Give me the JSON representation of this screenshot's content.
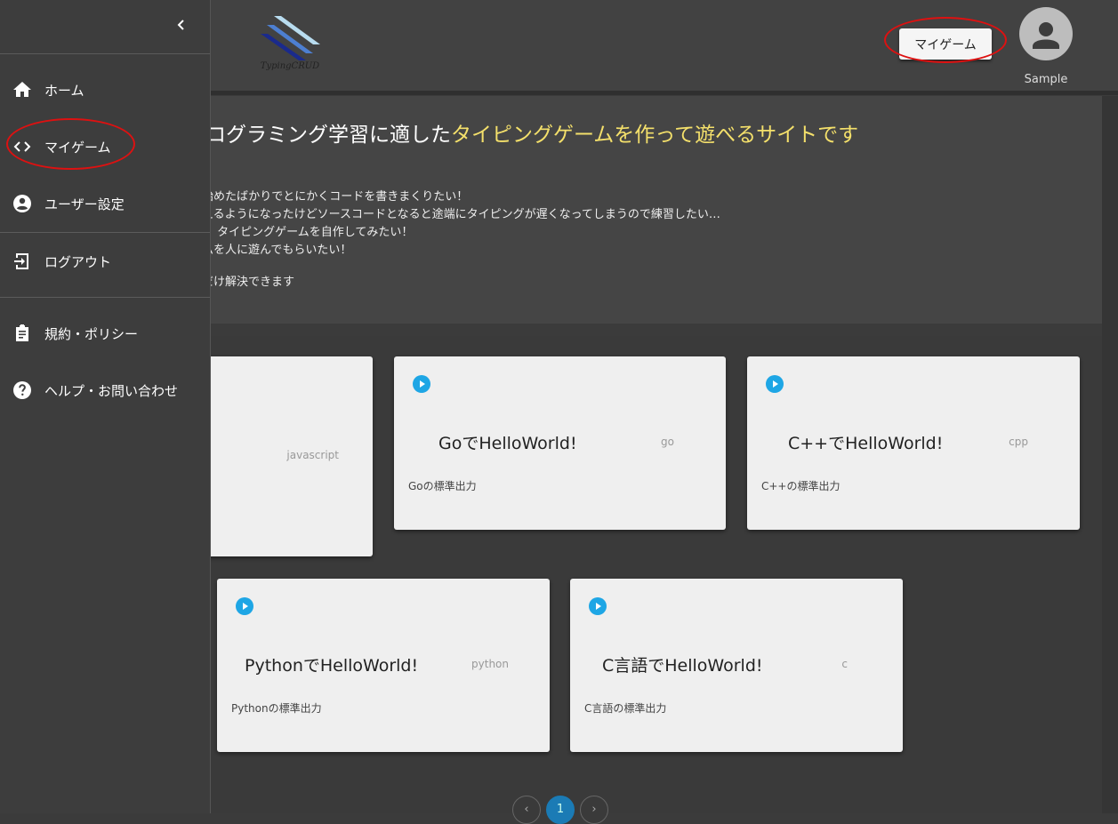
{
  "header": {
    "logo_text": "TypingCRUD",
    "mygame_button": "マイゲーム",
    "username": "Sample"
  },
  "hero": {
    "title_plain": "ログラミング学習に適した",
    "title_accent": "タイピングゲームを作って遊べるサイトです",
    "lines": [
      "始めたばかりでとにかくコードを書きまくりたい！",
      "えるようになったけどソースコードとなると途端にタイピングが遅くなってしまうので練習したい…",
      "く タイピングゲームを自作してみたい！",
      "ムを人に遊んでもらいたい！"
    ],
    "footer": "だけ解決できます"
  },
  "cards": [
    {
      "title": "",
      "lang": "javascript",
      "desc": ""
    },
    {
      "title": "GoでHelloWorld!",
      "lang": "go",
      "desc": "Goの標準出力"
    },
    {
      "title": "C++でHelloWorld!",
      "lang": "cpp",
      "desc": "C++の標準出力"
    },
    {
      "title": "PythonでHelloWorld!",
      "lang": "python",
      "desc": "Pythonの標準出力"
    },
    {
      "title": "C言語でHelloWorld!",
      "lang": "c",
      "desc": "C言語の標準出力"
    }
  ],
  "pagination": {
    "prev": "‹",
    "current": "1",
    "next": "›"
  },
  "sidebar": {
    "items": [
      {
        "label": "ホーム",
        "icon": "home-icon"
      },
      {
        "label": "マイゲーム",
        "icon": "code-icon"
      },
      {
        "label": "ユーザー設定",
        "icon": "account-circle-icon"
      },
      {
        "label": "ログアウト",
        "icon": "logout-icon"
      },
      {
        "label": "規約・ポリシー",
        "icon": "clipboard-icon"
      },
      {
        "label": "ヘルプ・お問い合わせ",
        "icon": "help-icon"
      }
    ]
  },
  "colors": {
    "accent": "#f4e06b",
    "play": "#1ea6e5",
    "annotation": "#dd1111"
  }
}
